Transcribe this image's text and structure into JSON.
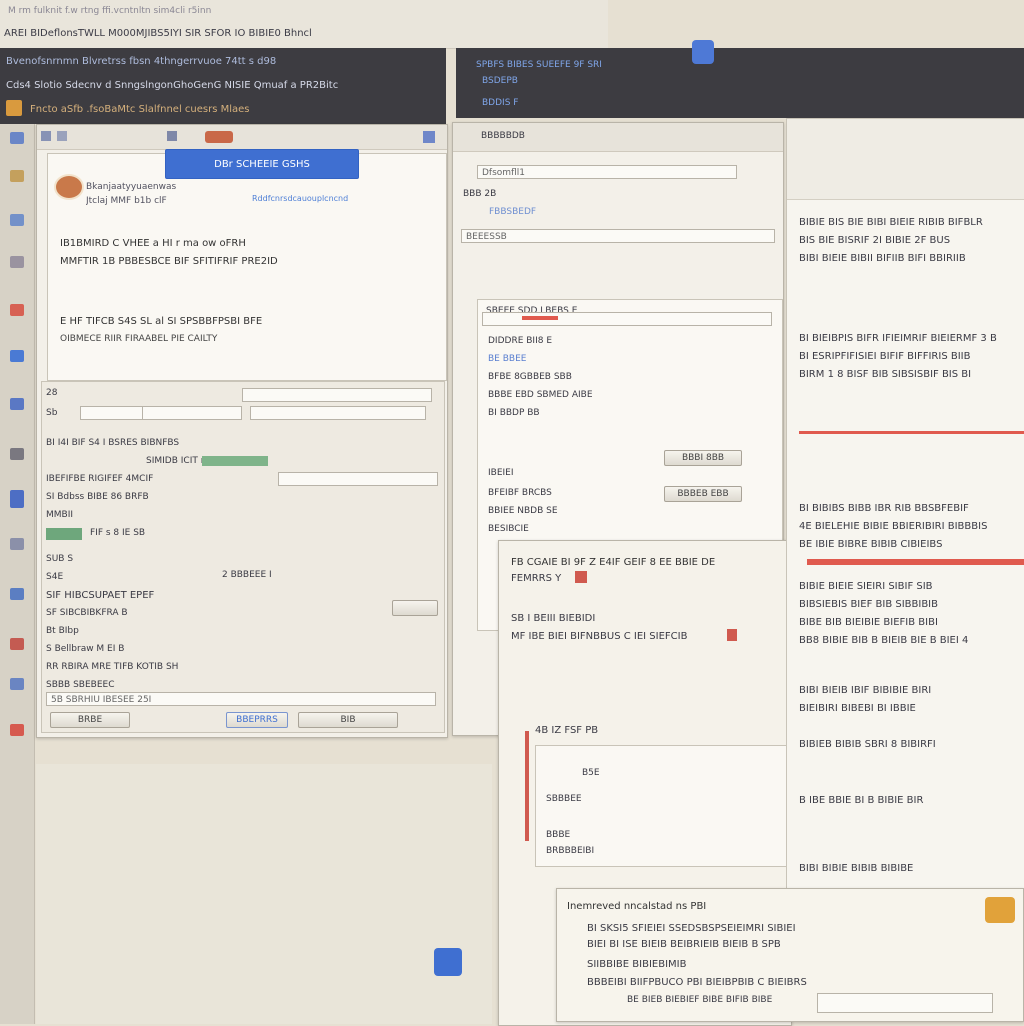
{
  "top_bar": {
    "line1": "M rm fulknit f.w rtng ffi.vcntnltn sim4cli r5inn",
    "line2": "AREI BIDeflonsTWLL M000MJIBS5IYI SIR SFOR IO BIBIE0 Bhncl"
  },
  "left_window": {
    "title1": "Bvenofsnrnmn Blvretrss fbsn 4thngerrvuoe 74tt s d98",
    "title2": "Cds4 Slotio Sdecnv d SnngslngonGhoGenG NISIE Qmuaf a PR2Bitc",
    "title3": "Fncto aSfb .fsoBaMtc Slalfnnel cuesrs Mlaes",
    "blue_button": "DBr SCHEEIE GSHS",
    "info_line1": "Bkanjaatyyuaenwas",
    "info_line2": "Jtclaj MMF b1b clF",
    "info_link": "Rddfcnrsdcauouplcncnd",
    "msg1": "IB1BMIRD C VHEE a HI r ma ow oFRH",
    "msg2": "MMFTIR 1B PBBESBCE BIF SFITIFRIF PRE2ID",
    "msg3": "E HF TIFCB S4S SL al SI SPSBBFPSBI BFE",
    "msg4": "OIBMECE RIIR FIRAABEL PIE CAILTY",
    "form_label": "28",
    "row_sb": "Sb",
    "row1": "BI I4I BIF S4 I BSRES BIBNFBS",
    "row2": "SIMIDB ICIT n ESBBHBI",
    "row3": "IBEFIFBE RIGIFEF 4MCIF",
    "row4": "SI Bdbss BIBE 86 BRFB",
    "row5": "MMBII",
    "row6": "FIF s 8 IE SB",
    "row7": "SUB S",
    "row8": "S4E",
    "row9": "SIF HIBCSUPAET EPEF",
    "row10": "2 BBBEEE I",
    "row11": "SF SIBCBIBKFRA B",
    "row12": "Bt BIbp",
    "row13": "S Bellbraw M EI B",
    "row14": "RR RBIRA MRE TIFB KOTIB SH",
    "row15": "SBBB SBEBEEC",
    "row16": "5B SBRHIU IBESEE 25I",
    "btn_ok": "BRBE",
    "btn_accent": "BBEPRRS",
    "btn_cancel": "BIB"
  },
  "top_right_bar": {
    "line1": "SPBFS BIBES  SUEEFE 9F SRI",
    "line2": "BSDEPB",
    "line3": "BDDIS F"
  },
  "middle_window": {
    "title": "BBBBBDB",
    "field1": "Dfsomfll1",
    "line1": "BBB 2B",
    "line2": "FBBSBEDF",
    "nav_line": "BEEESSB",
    "row_title": "SBEEE SDD LBEBS E",
    "r1": "DIDDRE BII8 E",
    "r2": "BE BBEE",
    "r3": "BFBE 8GBBEB SBB",
    "r4": "BBBE EBD SBMED AIBE",
    "r5": "BI BBDP BB",
    "r6": "IBEIEI",
    "r7": "BFEIBF BRCBS",
    "r8": "BBIEE NBDB SE",
    "r9": "BESIBCIE",
    "btn1": "BBBI 8BB",
    "btn2": "BBBEB EBB"
  },
  "dialog": {
    "head1": "FB CGAIE BI 9F Z E4IF GEIF 8 EE BBIE DE",
    "head2": "FEMRRS Y",
    "line1": "SB I BEIII BIEBIDI",
    "line2": "MF IBE BIEI BIFNBBUS C IEI SIEFCIB",
    "sub_title": "4B IZ FSF PB",
    "s1": "B5E",
    "s2": "SBBBEE",
    "s3": "BBBE",
    "s4": "BRBBBEIBI"
  },
  "right_panel": {
    "r1": "BIBIE BIS BIE BIBI BIEIE RIBIB BIFBLR",
    "r2": "BIS BIE BISRIF 2I BIBIE 2F BUS",
    "r3": "BIBI BIEIE BIBII BIFIIB BIFI BBIRIIB",
    "r4": "BI BIEIBPIS BIFR IFIEIMRIF BIEIERMF 3 B",
    "r5": "BI ESRIPFIFISIEI BIFIF BIFFIRIS BIIB",
    "r6": "BIRM 1 8 BISF BIB SIBSISBIF BIS BI",
    "r7": "BI BIBIBS BIBB IBR RIB BBSBFEBIF",
    "r8": "4E BIELEHIE BIBIE BBIERIBIRI BIBBBIS",
    "r9": "BE IBIE BIBRE BIBIB CIBIEIBS",
    "r10": "BIBIE BIEIE SIEIRI SIBIF SIB",
    "r11": "BIBSIEBIS BIEF BIB SIBBIBIB",
    "r12": "BIBE BIB BIEIBIE BIEFIB BIBI",
    "r13": "BB8 BIBIE BIB B BIEIB BIE B BIEI 4",
    "r14": "BIBI BIEIB IBIF BIBIBIE BIRI",
    "r15": "BIEIBIRI BIBEBI BI IBBIE",
    "r16": "BIBIEB BIBIB SBRI 8 BIBIRFI",
    "r17": "B IBE BBIE BI B BIBIE BIR",
    "r18": "BIBI BIBIE BIBIB BIBIBE"
  },
  "bottom_dialog": {
    "title": "Inemreved nncalstad ns PBI",
    "l1": "BI SKSI5 SFIEIEI SSEDSBSPSEIEIMRI SIBIEI",
    "l2": "BIEI BI ISE BIEIB BEIBRIEIB BIEIB B SPB",
    "l3": "SIIBBIBE BIBIEBIMIB",
    "l4": "BBBEIBI BIIFPBUCO PBI BIEIBPBIB C BIEIBRS",
    "l5": "BE BIEB BIEBIEF BIBE BIFIB BIBE"
  },
  "colors": {
    "accent_blue": "#3f6fd1",
    "titlebar_dark": "#3d3c41",
    "red_accent": "#e05a4e",
    "orange_badge": "#e1a23a",
    "background": "#e6e0d2"
  },
  "icons": [
    "shield-icon",
    "folder-icon",
    "user-icon",
    "gear-icon",
    "mail-icon",
    "globe-icon",
    "document-icon",
    "chart-icon"
  ]
}
